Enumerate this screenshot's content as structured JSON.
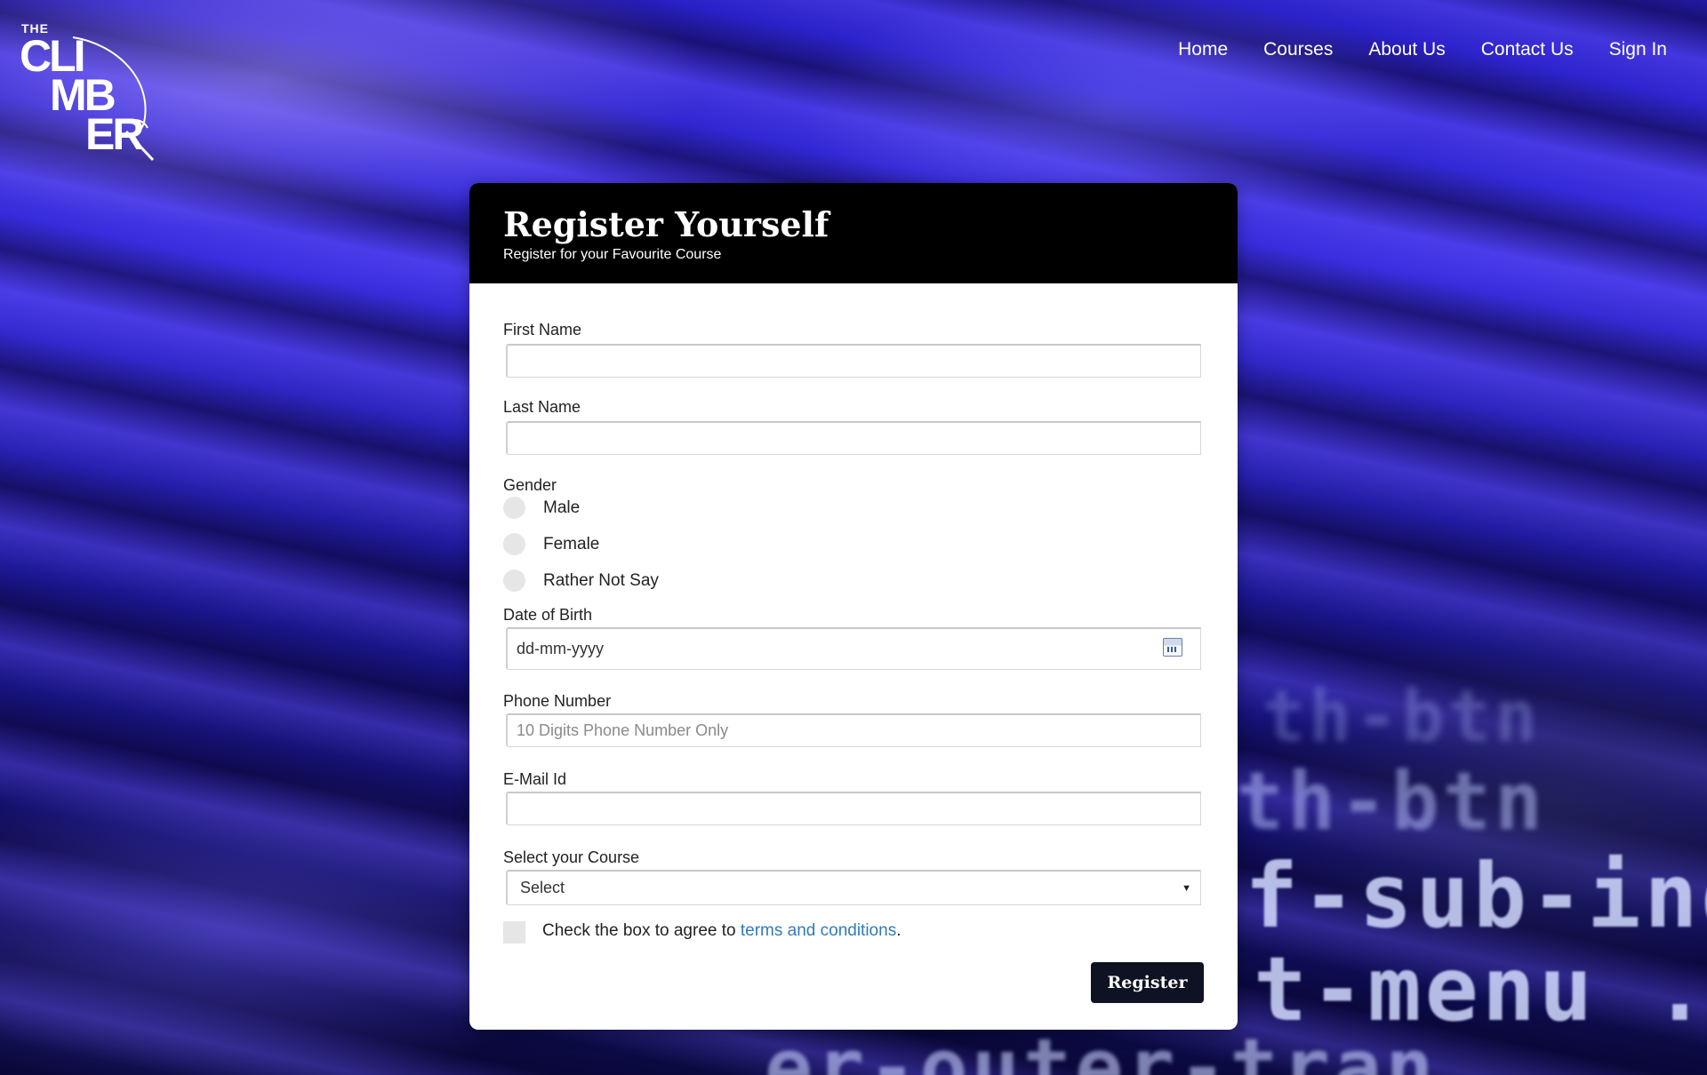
{
  "logo": {
    "the": "THE",
    "line1": "CLI",
    "line2": "MB",
    "line3": "ER"
  },
  "nav": {
    "items": [
      "Home",
      "Courses",
      "About Us",
      "Contact Us",
      "Sign In"
    ]
  },
  "background_code": {
    "line1": "f-sub-ind",
    "line2": "t-menu .",
    "line3": "th-btn",
    "line4": "er-outer-tran"
  },
  "form": {
    "title": "Register Yourself",
    "subtitle": "Register for your Favourite Course",
    "first_name_label": "First Name",
    "first_name_value": "",
    "last_name_label": "Last Name",
    "last_name_value": "",
    "gender_label": "Gender",
    "gender_options": [
      "Male",
      "Female",
      "Rather Not Say"
    ],
    "dob_label": "Date of Birth",
    "dob_placeholder": "dd-mm-yyyy",
    "phone_label": "Phone Number",
    "phone_placeholder": "10 Digits Phone Number Only",
    "email_label": "E-Mail Id",
    "email_value": "",
    "course_label": "Select your Course",
    "course_selected": "Select",
    "terms_text": "Check the box to agree to ",
    "terms_link": "terms and conditions",
    "terms_end": ".",
    "register_label": "Register"
  },
  "colors": {
    "header_bg": "#000000",
    "button_bg": "#0f1222",
    "link": "#337ab7"
  },
  "icons": {
    "calendar": "calendar-icon",
    "dropdown": "chevron-down-icon"
  }
}
